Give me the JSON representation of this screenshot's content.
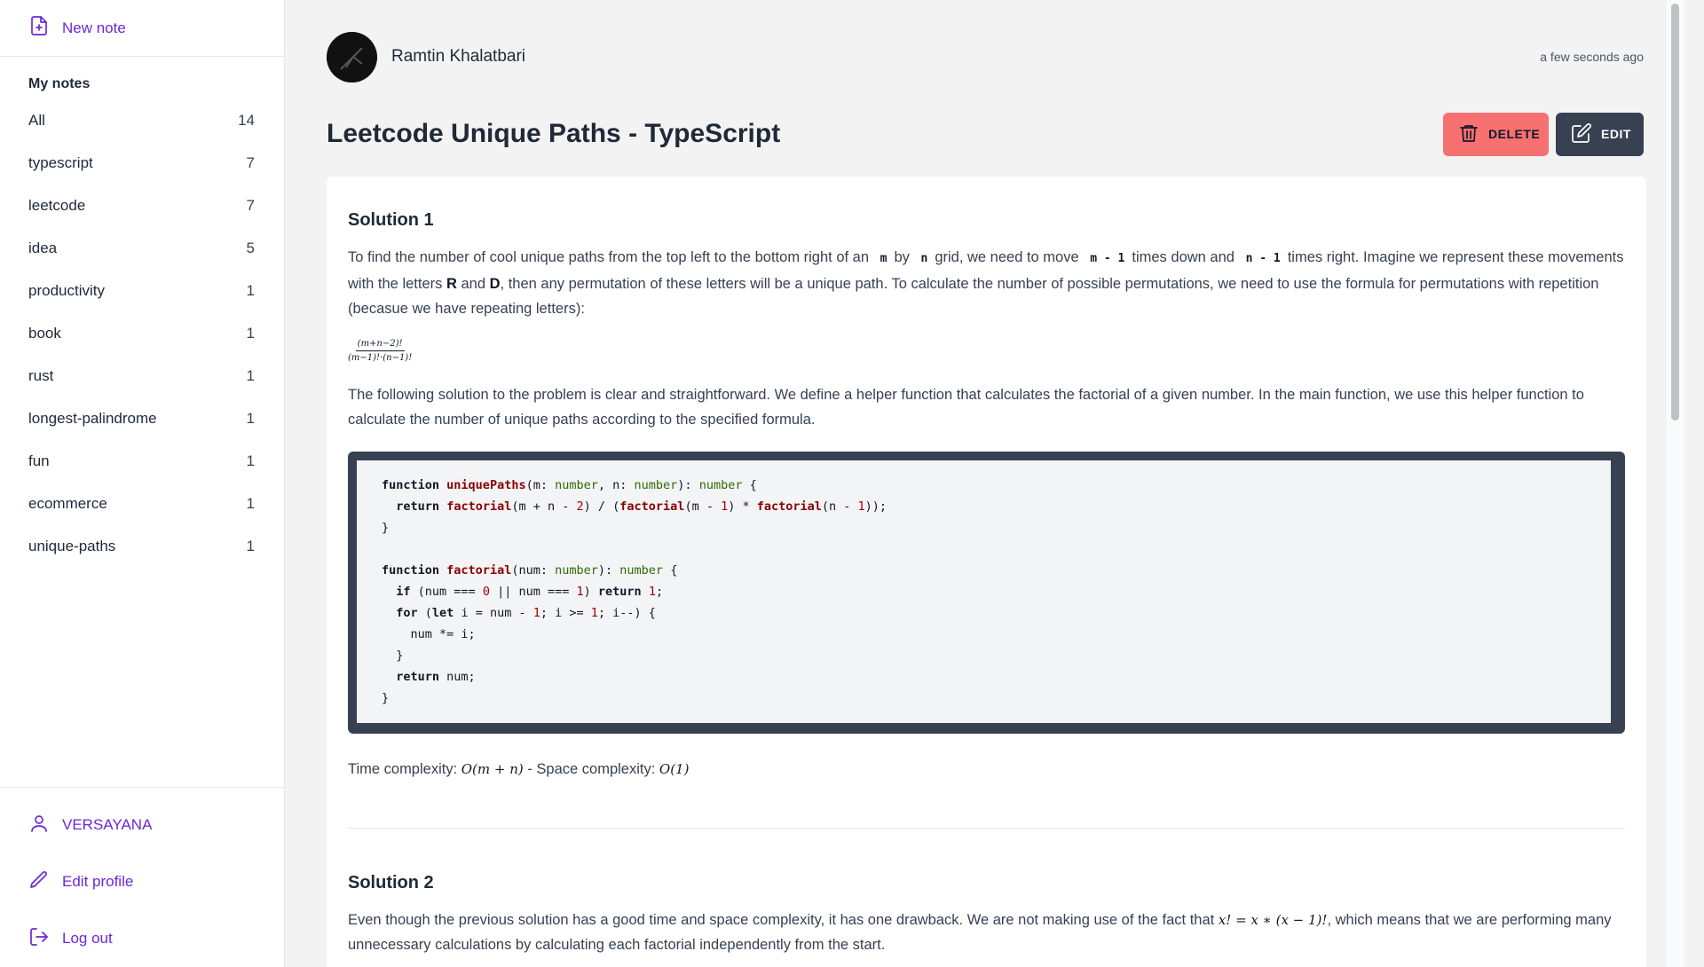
{
  "sidebar": {
    "new_note_label": "New note",
    "section_title": "My notes",
    "tags": [
      {
        "label": "All",
        "count": "14"
      },
      {
        "label": "typescript",
        "count": "7"
      },
      {
        "label": "leetcode",
        "count": "7"
      },
      {
        "label": "idea",
        "count": "5"
      },
      {
        "label": "productivity",
        "count": "1"
      },
      {
        "label": "book",
        "count": "1"
      },
      {
        "label": "rust",
        "count": "1"
      },
      {
        "label": "longest-palindrome",
        "count": "1"
      },
      {
        "label": "fun",
        "count": "1"
      },
      {
        "label": "ecommerce",
        "count": "1"
      },
      {
        "label": "unique-paths",
        "count": "1"
      }
    ],
    "username": "VERSAYANA",
    "edit_profile_label": "Edit profile",
    "logout_label": "Log out"
  },
  "note": {
    "author": "Ramtin Khalatbari",
    "timestamp": "a few seconds ago",
    "title": "Leetcode Unique Paths - TypeScript",
    "delete_label": "DELETE",
    "edit_label": "EDIT",
    "solution1": {
      "heading": "Solution 1",
      "p1": {
        "t1": "To find the number of cool unique paths from the top left to the bottom right of an",
        "c1": "m",
        "t2": "by",
        "c2": "n",
        "t3": "grid, we need to move",
        "c3": "m - 1",
        "t4": "times down and",
        "c4": "n - 1",
        "t5": "times right. Imagine we represent these movements with the letters",
        "b1": "R",
        "t6": "and",
        "b2": "D",
        "t7": ", then any permutation of these letters will be a unique path. To calculate the number of possible permutations, we need to use the formula for permutations with repetition (becasue we have repeating letters):"
      },
      "formula_num": "(m+n−2)!",
      "formula_den": "(m−1)!·(n−1)!",
      "p2": "The following solution to the problem is clear and straightforward. We define a helper function that calculates the factorial of a given number. In the main function, we use this helper function to calculate the number of unique paths according to the specified formula.",
      "code": {
        "l1": {
          "kw": "function",
          "fn": "uniquePaths",
          "a": "(m: ",
          "t1": "number",
          "b": ", n: ",
          "t2": "number",
          "c": "): ",
          "t3": "number",
          "d": " {"
        },
        "l2": {
          "pre": "  ",
          "kw": "return",
          "fn1": "factorial",
          "a": "(m + n - ",
          "n1": "2",
          "b": ") / (",
          "fn2": "factorial",
          "c": "(m - ",
          "n2": "1",
          "d": ") * ",
          "fn3": "factorial",
          "e": "(n - ",
          "n3": "1",
          "f": "));"
        },
        "l3": "}",
        "l5": {
          "kw": "function",
          "fn": "factorial",
          "a": "(num: ",
          "t1": "number",
          "b": "): ",
          "t2": "number",
          "c": " {"
        },
        "l6": {
          "pre": "  ",
          "kw1": "if",
          "a": " (num === ",
          "n1": "0",
          "b": " || num === ",
          "n2": "1",
          "c": ") ",
          "kw2": "return",
          "d": " ",
          "n3": "1",
          "e": ";"
        },
        "l7": {
          "pre": "  ",
          "kw1": "for",
          "a": " (",
          "kw2": "let",
          "b": " i = num - ",
          "n1": "1",
          "c": "; i >= ",
          "n2": "1",
          "d": "; i--) {"
        },
        "l8": "    num *= i;",
        "l9": "  }",
        "l10": {
          "pre": "  ",
          "kw": "return",
          "a": " num;"
        },
        "l11": "}"
      },
      "complexity": {
        "t1": "Time complexity: ",
        "m1": "O(m + n)",
        "t2": " - Space complexity: ",
        "m2": "O(1)"
      }
    },
    "solution2": {
      "heading": "Solution 2",
      "t1": "Even though the previous solution has a good time and space complexity, it has one drawback. We are not making use of the fact that ",
      "m1": "x! = x ∗ (x − 1)!",
      "t2": ", which means that we are performing many unnecessary calculations by calculating each factorial independently from the start."
    }
  }
}
